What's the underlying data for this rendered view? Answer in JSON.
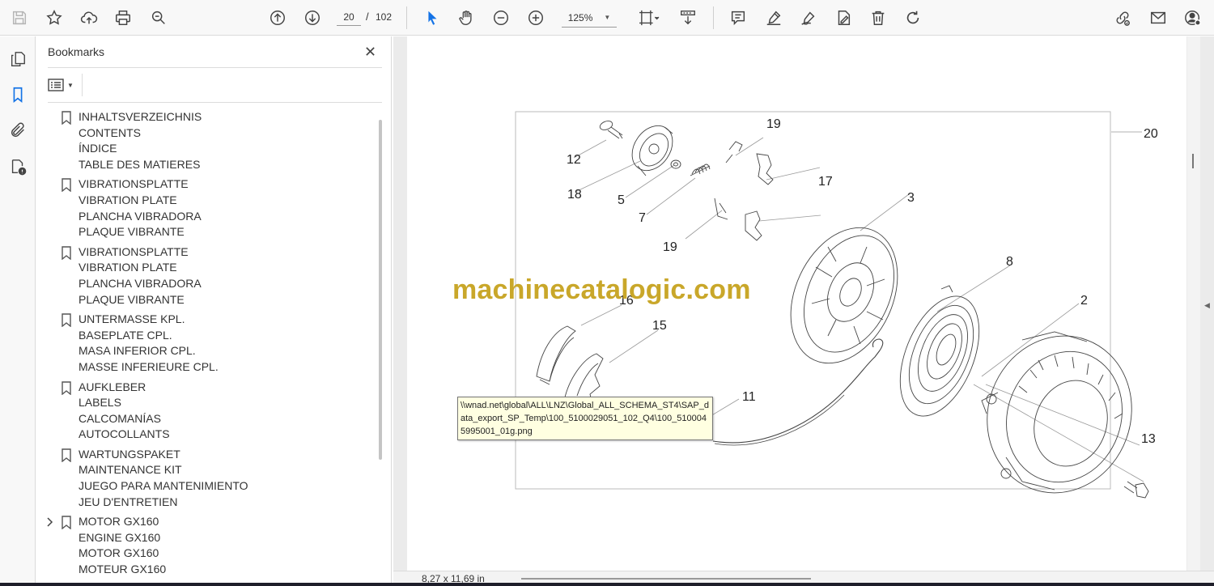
{
  "toolbar": {
    "current_page": "20",
    "page_separator": "/",
    "total_pages": "102",
    "zoom_level": "125%",
    "accent_color": "#1473e6"
  },
  "bookmarks_panel": {
    "title": "Bookmarks",
    "items": [
      {
        "lines": [
          "INHALTSVERZEICHNIS",
          "CONTENTS",
          "ÍNDICE",
          "TABLE DES MATIERES"
        ],
        "expandable": false
      },
      {
        "lines": [
          "VIBRATIONSPLATTE",
          "VIBRATION PLATE",
          "PLANCHA VIBRADORA",
          "PLAQUE VIBRANTE"
        ],
        "expandable": false
      },
      {
        "lines": [
          "VIBRATIONSPLATTE",
          "VIBRATION PLATE",
          "PLANCHA VIBRADORA",
          "PLAQUE VIBRANTE"
        ],
        "expandable": false
      },
      {
        "lines": [
          "UNTERMASSE KPL.",
          "BASEPLATE CPL.",
          "MASA INFERIOR CPL.",
          "MASSE INFERIEURE CPL."
        ],
        "expandable": false
      },
      {
        "lines": [
          "AUFKLEBER",
          "LABELS",
          "CALCOMANÍAS",
          "AUTOCOLLANTS"
        ],
        "expandable": false
      },
      {
        "lines": [
          "WARTUNGSPAKET",
          "MAINTENANCE KIT",
          "JUEGO PARA MANTENIMIENTO",
          "JEU D'ENTRETIEN"
        ],
        "expandable": false
      },
      {
        "lines": [
          "MOTOR GX160",
          "ENGINE GX160",
          "MOTOR GX160",
          "MOTEUR GX160"
        ],
        "expandable": true
      }
    ]
  },
  "document": {
    "watermark": "machinecatalogic.com",
    "part_numbers": {
      "n12": "12",
      "n18": "18",
      "n5": "5",
      "n7": "7",
      "n19a": "19",
      "n19b": "19",
      "n17": "17",
      "n3": "3",
      "n8": "8",
      "n2": "2",
      "n16": "16",
      "n15": "15",
      "n11": "11",
      "n13": "13",
      "n20": "20"
    },
    "tooltip": "\\\\wnad.net\\global\\ALL\\LNZ\\Global_ALL_SCHEMA_ST4\\SAP_data_export_SP_Temp\\100_5100029051_102_Q4\\100_5100045995001_01g.png"
  },
  "statusbar": {
    "page_size": "8,27 x 11,69 in"
  }
}
